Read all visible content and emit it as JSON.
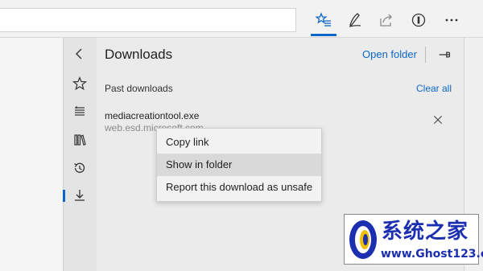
{
  "panel": {
    "title": "Downloads",
    "open_folder_label": "Open folder",
    "section_title": "Past downloads",
    "clear_all_label": "Clear all"
  },
  "download_item": {
    "file_name": "mediacreationtool.exe",
    "source": "web.esd.microsoft.com"
  },
  "context_menu": {
    "items": [
      {
        "label": "Copy link"
      },
      {
        "label": "Show in folder"
      },
      {
        "label": "Report this download as unsafe"
      }
    ],
    "highlighted_item": "Show in folder"
  },
  "toolbar_icons": [
    "favorites-icon",
    "pen-icon",
    "share-icon",
    "extension-icon",
    "more-icon"
  ],
  "rail_icons": [
    "back-icon",
    "favorites-icon",
    "reading-list-icon",
    "books-icon",
    "history-icon",
    "downloads-icon"
  ],
  "watermark": {
    "title": "系统之家",
    "url": "www.Ghost123.com"
  },
  "colors": {
    "accent": "#0a67c8",
    "panel_bg": "#ebebeb",
    "menu_bg": "#f2f2f2",
    "menu_hover": "#d9d9d9"
  }
}
